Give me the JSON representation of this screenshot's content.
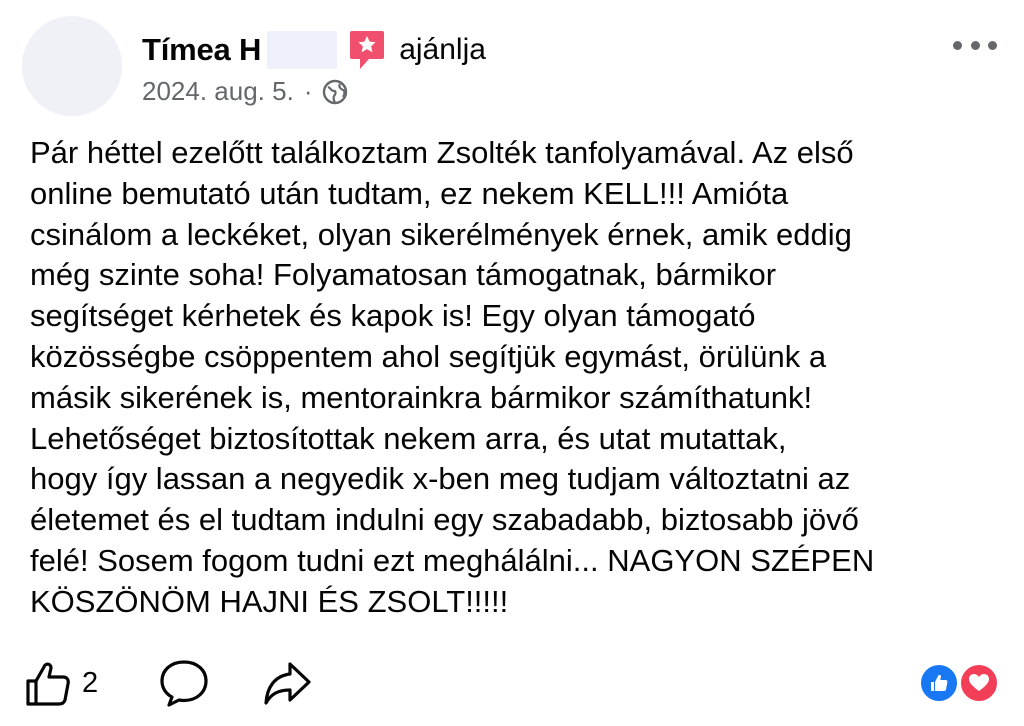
{
  "post": {
    "author_name": "Tímea H",
    "recommends_label": "ajánlja",
    "date": "2024. aug. 5.",
    "meta_separator": "·",
    "audience_icon": "globe-icon",
    "more_icon": "more-options-icon",
    "text": "Pár héttel ezelőtt találkoztam Zsolték tanfolyamával. Az első\nonline bemutató után tudtam, ez nekem KELL!!! Amióta\ncsinálom a leckéket, olyan sikerélmények érnek, amik eddig\nmég szinte soha! Folyamatosan támogatnak, bármikor\nsegítséget kérhetek és kapok is! Egy olyan támogató\nközösségbe csöppentem ahol segítjük egymást, örülünk a\nmásik sikerének is, mentorainkra bármikor számíthatunk!\nLehetőséget biztosítottak nekem arra, és utat mutattak,\nhogy így lassan a negyedik x-ben meg tudjam változtatni az\néletemet és el tudtam indulni egy szabadabb, biztosabb jövő\nfelé! Sosem fogom tudni ezt meghálálni... NAGYON SZÉPEN\nKÖSZÖNÖM HAJNI ÉS ZSOLT!!!!!"
  },
  "actions": {
    "like_count": "2",
    "like_icon": "thumbs-up-icon",
    "comment_icon": "comment-icon",
    "share_icon": "share-icon"
  },
  "reactions": [
    "like-reaction-icon",
    "love-reaction-icon"
  ],
  "colors": {
    "recommend_badge": "#f0506e",
    "meta_gray": "#65676b",
    "like_blue": "#1877f2",
    "love_red": "#f33e58"
  }
}
